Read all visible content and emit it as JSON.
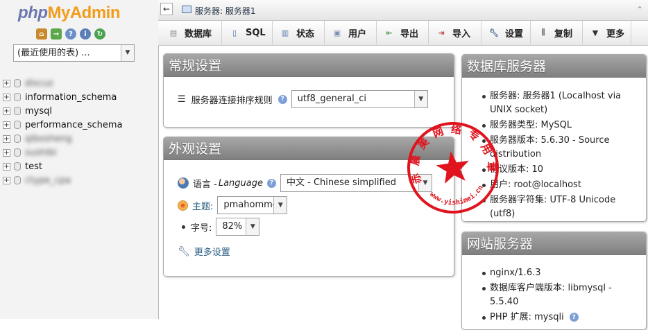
{
  "logo": {
    "php": "php",
    "my": "My",
    "admin": "Admin"
  },
  "nav_icons": [
    "home-icon",
    "logout-icon",
    "help-icon",
    "docs-icon",
    "reload-icon"
  ],
  "recent_select": {
    "value": "(最近使用的表) ..."
  },
  "databases": [
    {
      "name": "discuz",
      "blurred": true
    },
    {
      "name": "information_schema",
      "blurred": false
    },
    {
      "name": "mysql",
      "blurred": false
    },
    {
      "name": "performance_schema",
      "blurred": false
    },
    {
      "name": "qibosheng",
      "blurred": true
    },
    {
      "name": "sushibi",
      "blurred": true
    },
    {
      "name": "test",
      "blurred": false
    },
    {
      "name": "ctype_cpa",
      "blurred": true
    }
  ],
  "breadcrumb": "服务器: 服务器1",
  "tabs": [
    {
      "label": "数据库",
      "icon": "database-icon"
    },
    {
      "label": "SQL",
      "icon": "sql-icon"
    },
    {
      "label": "状态",
      "icon": "status-icon"
    },
    {
      "label": "用户",
      "icon": "users-icon"
    },
    {
      "label": "导出",
      "icon": "export-icon"
    },
    {
      "label": "导入",
      "icon": "import-icon"
    },
    {
      "label": "设置",
      "icon": "settings-icon"
    },
    {
      "label": "复制",
      "icon": "replication-icon"
    },
    {
      "label": "更多",
      "icon": "more-icon"
    }
  ],
  "general": {
    "title": "常规设置",
    "collation_label": "服务器连接排序规则",
    "collation_value": "utf8_general_ci"
  },
  "appearance": {
    "title": "外观设置",
    "language_label": "语言 - ",
    "language_label_en": "Language",
    "language_value": "中文 - Chinese simplified",
    "theme_label": "主题:",
    "theme_value": "pmahomme",
    "fontsize_label": "字号:",
    "fontsize_value": "82%",
    "more_settings": "更多设置"
  },
  "db_server": {
    "title": "数据库服务器",
    "items": [
      "服务器: 服务器1 (Localhost via UNIX socket)",
      "服务器类型: MySQL",
      "服务器版本: 5.6.30 - Source distribution",
      "协议版本: 10",
      "用户: root@localhost",
      "服务器字符集: UTF-8 Unicode (utf8)"
    ]
  },
  "web_server": {
    "title": "网站服务器",
    "items": [
      "nginx/1.6.3",
      "数据库客户端版本: libmysql - 5.5.40",
      "PHP 扩展: mysqli"
    ]
  },
  "stamp": {
    "text": "赤 晨 美 网 络 专 用 章",
    "url": "www.yishimei.cn",
    "color": "#e0141e"
  }
}
